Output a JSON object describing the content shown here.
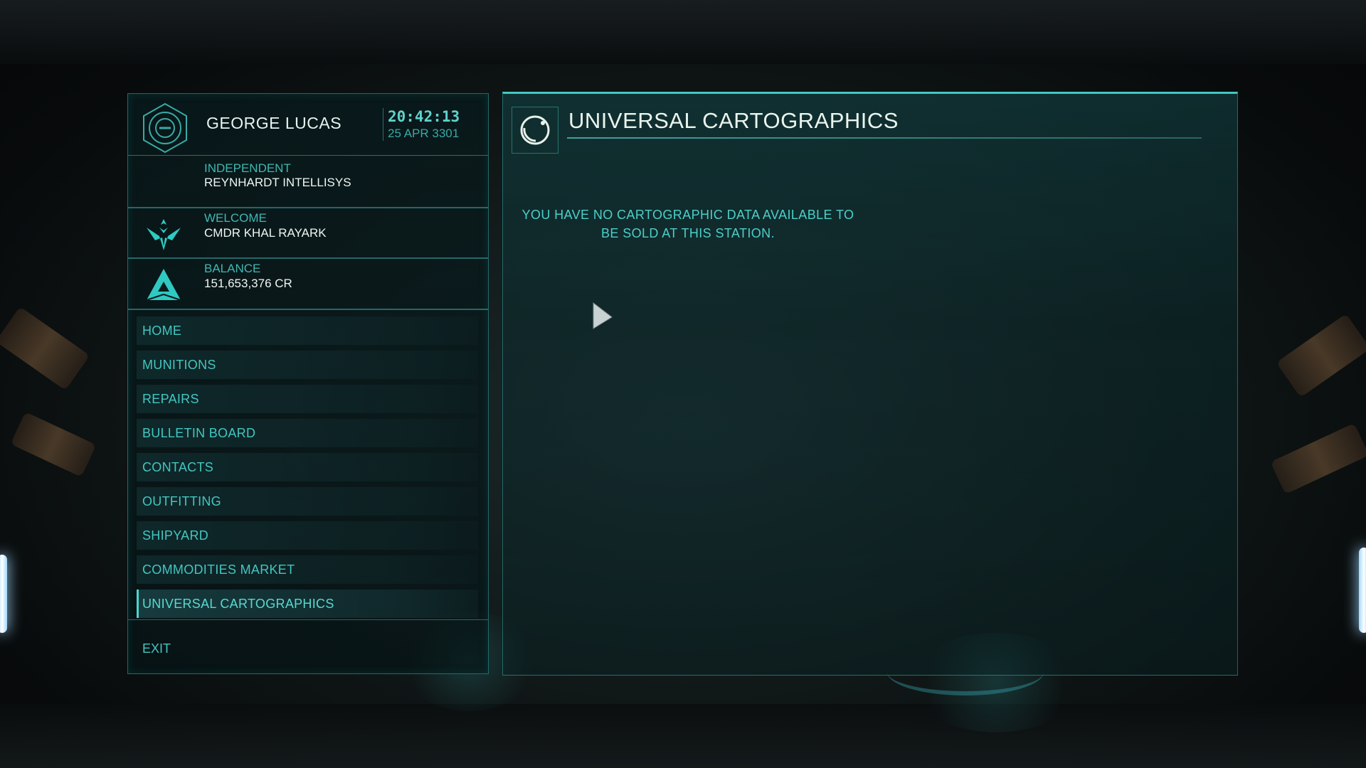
{
  "commander": {
    "name": "GEORGE LUCAS",
    "clock": "20:42:13",
    "date": "25 APR 3301",
    "allegiance_label": "INDEPENDENT",
    "allegiance_value": "REYNHARDT INTELLISYS",
    "welcome_label": "WELCOME",
    "welcome_value": "CMDR KHAL RAYARK",
    "balance_label": "BALANCE",
    "balance_value": "151,653,376 CR"
  },
  "nav": {
    "items": [
      {
        "label": "HOME"
      },
      {
        "label": "MUNITIONS"
      },
      {
        "label": "REPAIRS"
      },
      {
        "label": "BULLETIN BOARD"
      },
      {
        "label": "CONTACTS"
      },
      {
        "label": "OUTFITTING"
      },
      {
        "label": "SHIPYARD"
      },
      {
        "label": "COMMODITIES MARKET"
      },
      {
        "label": "UNIVERSAL CARTOGRAPHICS"
      }
    ],
    "active": "UNIVERSAL CARTOGRAPHICS",
    "exit_label": "EXIT"
  },
  "main": {
    "title": "UNIVERSAL CARTOGRAPHICS",
    "message_line1": "YOU HAVE NO CARTOGRAPHIC DATA AVAILABLE TO",
    "message_line2": "BE SOLD AT THIS STATION."
  },
  "colors": {
    "accent": "#43c6c0",
    "text_bright": "#eaf5ee",
    "panel_border": "#3fc9c3"
  },
  "icons": {
    "avatar": "hexagon-emblem-icon",
    "rank_combat": "wing-emblem-icon",
    "rank_trade": "pyramid-emblem-icon",
    "cartographics": "planet-orbit-icon",
    "cursor": "pointer-cursor-icon"
  }
}
